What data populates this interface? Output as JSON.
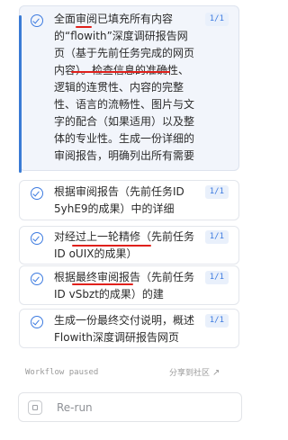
{
  "tasks": [
    {
      "text": "全面审阅已填充所有内容的“flowith”深度调研报告网页（基于先前任务完成的网页内容）。检查信息的准确性、逻辑的连贯性、内容的完整性、语言的流畅性、图片与文字的配合（如果适用）以及整体的专业性。生成一份详细的审阅报告，明确列出所有需要修改和优化的地方，为下一步的网页精修提供指导。",
      "count": "1/1"
    },
    {
      "text": "根据审阅报告（先前任务ID 5yhE9的成果）中的详细建…",
      "count": "1/1"
    },
    {
      "text": "对经过上一轮精修（先前任务ID oUIX的成果）的“flowith”深…",
      "count": "1/1"
    },
    {
      "text": "根据最终审阅报告（先前任务ID vSbzt的成果）的建议，…",
      "count": "1/1"
    },
    {
      "text": "生成一份最终交付说明，概述Flowith深度调研报告网页的…",
      "count": "1/1"
    }
  ],
  "footer": {
    "status": "Workflow paused",
    "share": "分享到社区",
    "rerun": "Re-run"
  }
}
